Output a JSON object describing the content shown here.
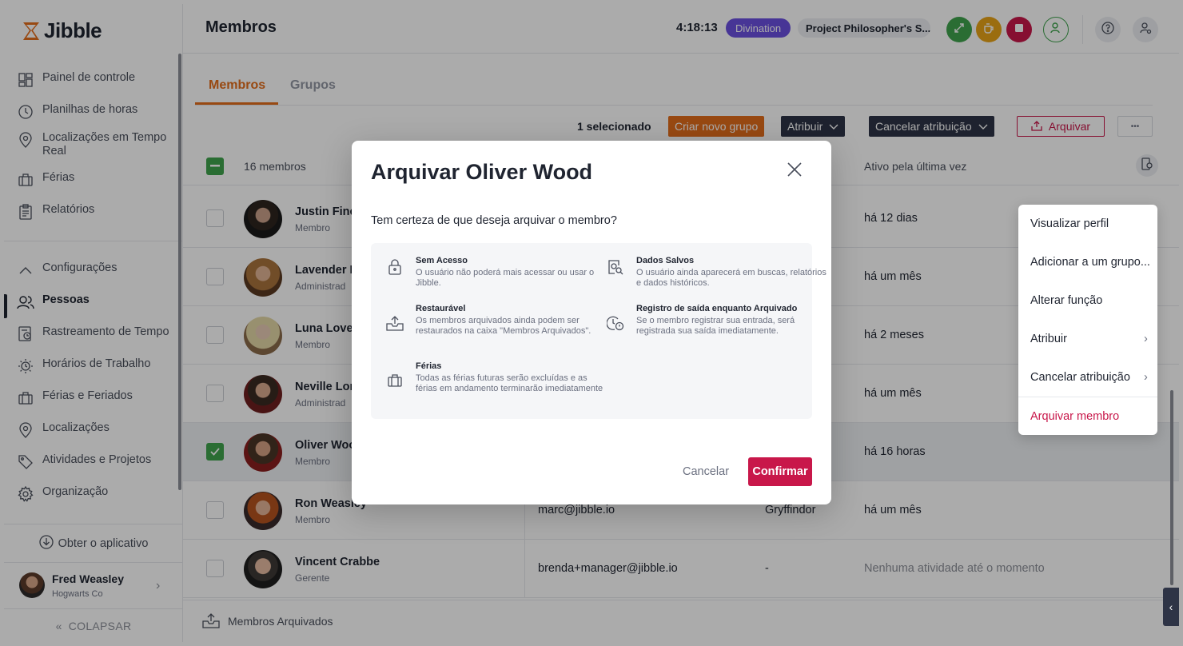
{
  "app": {
    "name": "Jibble"
  },
  "sidebar": {
    "items": [
      {
        "label": "Painel de controle",
        "icon": "dashboard-icon"
      },
      {
        "label": "Planilhas de horas",
        "icon": "clock-icon"
      },
      {
        "label": "Localizações em Tempo Real",
        "icon": "location-pin-icon"
      },
      {
        "label": "Férias",
        "icon": "suitcase-icon"
      },
      {
        "label": "Relatórios",
        "icon": "report-icon"
      },
      {
        "label": "Configurações",
        "icon": "chevron-up-icon"
      },
      {
        "label": "Pessoas",
        "icon": "people-icon",
        "active": true
      },
      {
        "label": "Rastreamento de Tempo",
        "icon": "time-tracking-icon"
      },
      {
        "label": "Horários de Trabalho",
        "icon": "work-schedule-icon"
      },
      {
        "label": "Férias e Feriados",
        "icon": "suitcase-icon"
      },
      {
        "label": "Localizações",
        "icon": "location-pin-icon"
      },
      {
        "label": "Atividades e Projetos",
        "icon": "tag-icon"
      },
      {
        "label": "Organização",
        "icon": "gear-icon"
      }
    ],
    "get_app": "Obter o aplicativo",
    "user": {
      "name": "Fred Weasley",
      "org": "Hogwarts Co"
    },
    "collapse": "COLAPSAR"
  },
  "header": {
    "title": "Membros",
    "timer": "4:18:13",
    "activity": "Divination",
    "project": "Project Philosopher's S...",
    "colors": {
      "activity": "#6a4fe0",
      "btn_green": "#3fa34d",
      "btn_yellow": "#e8a317",
      "btn_red": "#c8174a"
    }
  },
  "tabs": [
    {
      "label": "Membros",
      "active": true
    },
    {
      "label": "Grupos",
      "active": false
    }
  ],
  "toolbar": {
    "selected": "1 selecionado",
    "create_group": "Criar novo grupo",
    "assign": "Atribuir",
    "unassign": "Cancelar atribuição",
    "archive": "Arquivar",
    "more": "•••"
  },
  "table": {
    "count": "16 membros",
    "last_active_header": "Ativo pela última vez",
    "rows": [
      {
        "name": "Justin Finch",
        "role": "Membro",
        "email": "",
        "group": "",
        "last": "há 12 dias",
        "checked": false
      },
      {
        "name": "Lavender B",
        "role": "Administrad",
        "email": "",
        "group": "",
        "last": "há um mês",
        "checked": false
      },
      {
        "name": "Luna Lovego",
        "role": "Membro",
        "email": "",
        "group": "",
        "last": "há 2 meses",
        "checked": false
      },
      {
        "name": "Neville Lon",
        "role": "Administrad",
        "email": "",
        "group": "",
        "last": "há um mês",
        "checked": false
      },
      {
        "name": "Oliver Woo",
        "role": "Membro",
        "email": "",
        "group": "",
        "last": "há 16 horas",
        "checked": true
      },
      {
        "name": "Ron Weasley",
        "role": "Membro",
        "email": "marc@jibble.io",
        "group": "Gryffindor",
        "last": "há um mês",
        "checked": false
      },
      {
        "name": "Vincent Crabbe",
        "role": "Gerente",
        "email": "brenda+manager@jibble.io",
        "group": "-",
        "last": "Nenhuma atividade até o momento",
        "checked": false
      }
    ],
    "archived_members": "Membros Arquivados"
  },
  "context_menu": {
    "items": [
      {
        "label": "Visualizar perfil",
        "submenu": false
      },
      {
        "label": "Adicionar a um grupo...",
        "submenu": false
      },
      {
        "label": "Alterar função",
        "submenu": false
      },
      {
        "label": "Atribuir",
        "submenu": true
      },
      {
        "label": "Cancelar atribuição",
        "submenu": true
      },
      {
        "label": "Arquivar membro",
        "submenu": false,
        "danger": true
      }
    ]
  },
  "modal": {
    "title": "Arquivar Oliver Wood",
    "question": "Tem certeza de que deseja arquivar o membro?",
    "info": [
      {
        "title": "Sem Acesso",
        "text": "O usuário não poderá mais acessar ou usar o Jibble.",
        "icon": "lock-icon"
      },
      {
        "title": "Dados Salvos",
        "text": "O usuário ainda aparecerá em buscas, relatórios e dados históricos.",
        "icon": "saved-data-icon"
      },
      {
        "title": "Restaurável",
        "text": "Os membros arquivados ainda podem ser restaurados na caixa \"Membros Arquivados\".",
        "icon": "restore-icon"
      },
      {
        "title": "Registro de saída enquanto Arquivado",
        "text": "Se o membro registrar sua entrada, será registrada sua saída imediatamente.",
        "icon": "clock-out-icon"
      },
      {
        "title": "Férias",
        "text": "Todas as férias futuras serão excluídas e as férias em andamento terminarão imediatamente",
        "icon": "suitcase-icon"
      }
    ],
    "cancel": "Cancelar",
    "confirm": "Confirmar",
    "confirm_color": "#c8174a"
  }
}
